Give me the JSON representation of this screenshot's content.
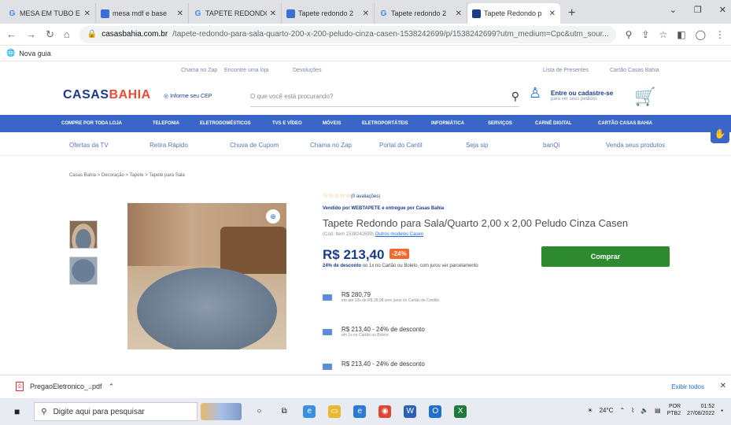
{
  "browser": {
    "tabs": [
      {
        "label": "MESA EM TUBO E",
        "icon": "google-icon"
      },
      {
        "label": "mesa mdf e base",
        "icon": "mercadolivre-icon"
      },
      {
        "label": "TAPETE REDONDO",
        "icon": "google-icon"
      },
      {
        "label": "Tapete redondo 2",
        "icon": "mercadolivre-icon"
      },
      {
        "label": "Tapete redondo 2",
        "icon": "google-icon"
      },
      {
        "label": "Tapete Redondo p",
        "icon": "casasbahia-icon"
      }
    ],
    "new_tab": "+",
    "url_host": "casasbahia.com.br",
    "url_path": "/tapete-redondo-para-sala-quarto-200-x-200-peludo-cinza-casen-1538242699/p/1538242699?utm_medium=Cpc&utm_sour...",
    "bookmark": "Nova guia"
  },
  "site": {
    "top_links": [
      "Chama no Zap",
      "Encontre uma loja",
      "Devoluções",
      "Lista de Presentes",
      "Cartão Casas Bahia"
    ],
    "logo_a": "CASAS",
    "logo_b": "BAHIA",
    "cep": "Informe seu CEP",
    "search_placeholder": "O que você está procurando?",
    "login_title": "Entre ou cadastre-se",
    "login_sub": "para ver seus pedidos",
    "menu": [
      "COMPRE POR TODA LOJA",
      "TELEFONIA",
      "ELETRODOMÉSTICOS",
      "TVS E VÍDEO",
      "MÓVEIS",
      "ELETROPORTÁTEIS",
      "INFORMÁTICA",
      "SERVIÇOS",
      "CARNÊ DIGITAL",
      "CARTÃO CASAS BAHIA"
    ],
    "subnav": [
      "Ofertas da TV",
      "Retira Rápido",
      "Chuva de Cupom",
      "Chama no Zap",
      "Portal do Cantil",
      "Seja sip",
      "banQi",
      "Venda seus produtos"
    ]
  },
  "product": {
    "breadcrumb": "Casas Bahia > Decoração > Tapete > Tapete para Sala",
    "stars": "☆☆☆☆☆",
    "reviews": "(0 avaliações)",
    "seller": "Vendido por WEBTAPETE e entregue por Casas Bahia",
    "title": "Tapete Redondo para Sala/Quarto 2,00 x 2,00 Peludo Cinza Casen",
    "code": "(Cod. Item 1538242699)",
    "code_link": "Outros modelos Casen",
    "price": "R$ 213,40",
    "discount_badge": "-24%",
    "desc_bold": "24% de desconto",
    "desc": "no 1x no Cartão ou Boleto, com juros ver parcelamento",
    "buy_button": "Comprar",
    "options": [
      {
        "price": "R$ 280,79",
        "note": "em até 10x de R$ 28,08 sem juros no Cartão de Crédito"
      },
      {
        "price": "R$ 213,40 - 24% de desconto",
        "note": "em 1x no Cartão ou Boleto"
      },
      {
        "price": "R$ 213,40 - 24% de desconto",
        "note": ""
      }
    ]
  },
  "downloads": {
    "file": "PregaoEletronico_..pdf",
    "show_all": "Exibir todos"
  },
  "taskbar": {
    "search": "Digite aqui para pesquisar",
    "temp": "24°C",
    "lang": "POR",
    "layout": "PTB2",
    "time": "01:52",
    "date": "27/08/2022"
  }
}
